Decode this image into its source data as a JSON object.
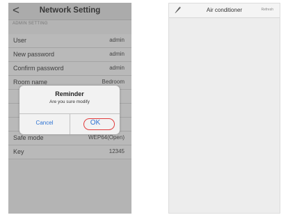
{
  "left_screen": {
    "title": "Network Setting",
    "back_glyph": "<",
    "section_header": "ADMIN SETTING",
    "rows": [
      {
        "label": "User",
        "value": "admin"
      },
      {
        "label": "New password",
        "value": "admin"
      },
      {
        "label": "Confirm password",
        "value": "admin"
      },
      {
        "label": "Room name",
        "value": "Bedroom"
      },
      {
        "label": "Safe mode",
        "value": "WEP64(Open)"
      },
      {
        "label": "Key",
        "value": "12345"
      }
    ],
    "dialog": {
      "title": "Reminder",
      "message": "Are you sure modify",
      "cancel_label": "Cancel",
      "ok_label": "OK",
      "highlight_color": "#e23b3b"
    }
  },
  "right_screen": {
    "title": "Air conditioner",
    "refresh_label": "Refresh",
    "left_icon": "pencil-icon"
  }
}
